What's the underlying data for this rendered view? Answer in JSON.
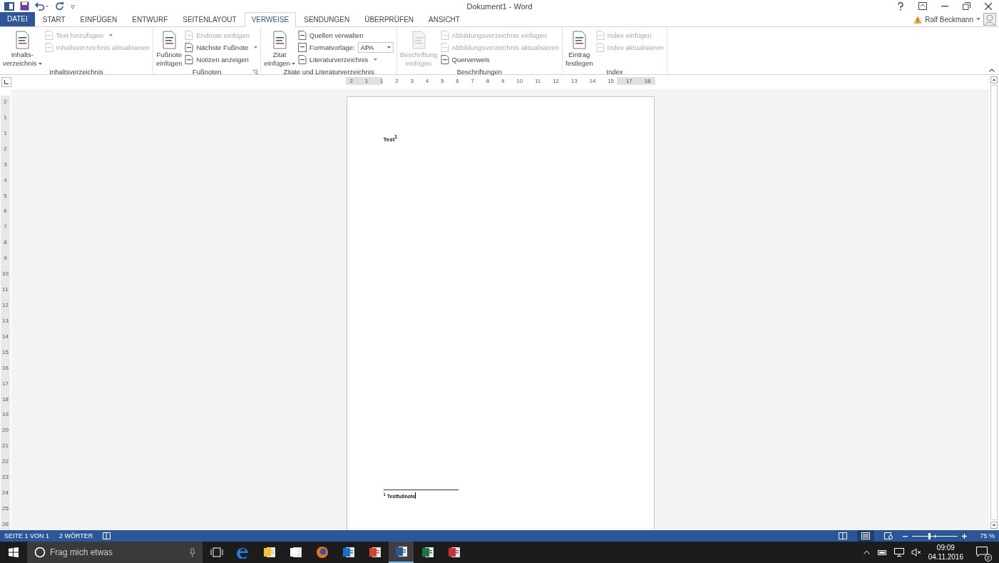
{
  "window": {
    "title": "Dokument1 - Word",
    "user": "Ralf Beckmann"
  },
  "tabs": [
    {
      "label": "DATEI",
      "kind": "file",
      "selected": false
    },
    {
      "label": "START",
      "kind": "tab",
      "selected": false
    },
    {
      "label": "EINFÜGEN",
      "kind": "tab",
      "selected": false
    },
    {
      "label": "ENTWURF",
      "kind": "tab",
      "selected": false
    },
    {
      "label": "SEITENLAYOUT",
      "kind": "tab",
      "selected": false
    },
    {
      "label": "VERWEISE",
      "kind": "tab",
      "selected": true
    },
    {
      "label": "SENDUNGEN",
      "kind": "tab",
      "selected": false
    },
    {
      "label": "ÜBERPRÜFEN",
      "kind": "tab",
      "selected": false
    },
    {
      "label": "ANSICHT",
      "kind": "tab",
      "selected": false
    }
  ],
  "ribbon": {
    "groups": [
      {
        "label": "Inhaltsverzeichnis",
        "large": [
          {
            "lines": [
              "Inhalts-",
              "verzeichnis"
            ],
            "disabled": false,
            "dropdown": true
          }
        ],
        "small": [
          {
            "label": "Text hinzufügen",
            "kind": "button",
            "disabled": true,
            "dropdown": true
          },
          {
            "label": "Inhaltsverzeichnis aktualisieren",
            "kind": "button",
            "disabled": true,
            "dropdown": false
          }
        ]
      },
      {
        "label": "Fußnoten",
        "launcher": true,
        "large": [
          {
            "lines": [
              "Fußnote",
              "einfügen"
            ],
            "disabled": false,
            "dropdown": false
          }
        ],
        "small": [
          {
            "label": "Endnote einfügen",
            "kind": "button",
            "disabled": true,
            "dropdown": false
          },
          {
            "label": "Nächste Fußnote",
            "kind": "button",
            "disabled": false,
            "dropdown": true
          },
          {
            "label": "Notizen anzeigen",
            "kind": "button",
            "disabled": false,
            "dropdown": false
          }
        ]
      },
      {
        "label": "Zitate und Literaturverzeichnis",
        "large": [
          {
            "lines": [
              "Zitat",
              "einfügen"
            ],
            "disabled": false,
            "dropdown": true
          }
        ],
        "small": [
          {
            "label": "Quellen verwalten",
            "kind": "button",
            "disabled": false,
            "dropdown": false
          },
          {
            "label": "Formatvorlage:",
            "kind": "select",
            "value": "APA"
          },
          {
            "label": "Literaturverzeichnis",
            "kind": "button",
            "disabled": false,
            "dropdown": true
          }
        ]
      },
      {
        "label": "Beschriftungen",
        "large": [
          {
            "lines": [
              "Beschriftung",
              "einfügen"
            ],
            "disabled": true,
            "dropdown": false
          }
        ],
        "small": [
          {
            "label": "Abbildungsverzeichnis einfügen",
            "kind": "button",
            "disabled": true,
            "dropdown": false
          },
          {
            "label": "Abbildungsverzeichnis aktualisieren",
            "kind": "button",
            "disabled": true,
            "dropdown": false
          },
          {
            "label": "Querverweis",
            "kind": "button",
            "disabled": false,
            "dropdown": false
          }
        ]
      },
      {
        "label": "Index",
        "large": [
          {
            "lines": [
              "Eintrag",
              "festlegen"
            ],
            "disabled": false,
            "dropdown": false
          }
        ],
        "small": [
          {
            "label": "Index einfügen",
            "kind": "button",
            "disabled": true,
            "dropdown": false
          },
          {
            "label": "Index aktualisieren",
            "kind": "button",
            "disabled": true,
            "dropdown": false
          }
        ]
      }
    ]
  },
  "ruler": {
    "horizontal": [
      "2",
      "1",
      "1",
      "2",
      "3",
      "4",
      "5",
      "6",
      "7",
      "8",
      "9",
      "10",
      "11",
      "12",
      "13",
      "14",
      "15",
      "17",
      "18"
    ],
    "vertical": [
      "2",
      "1",
      "1",
      "2",
      "3",
      "4",
      "5",
      "6",
      "7",
      "8",
      "9",
      "10",
      "11",
      "12",
      "13",
      "14",
      "15",
      "16",
      "17",
      "18",
      "19",
      "20",
      "21",
      "22",
      "23",
      "24",
      "25",
      "26"
    ]
  },
  "document": {
    "body": "Test$^{1}$",
    "footnote": "$^{1}$ Testfußnote"
  },
  "status_bar": {
    "page": "SEITE 1 VON 1",
    "words": "2 WÖRTER",
    "zoom": "75 %",
    "zoom_slider": {
      "level": 0.37
    }
  },
  "taskbar": {
    "search": {
      "placeholder": "Frag mich etwas"
    },
    "apps": [
      {
        "kind": "taskview",
        "selected": false
      },
      {
        "kind": "edge",
        "selected": false
      },
      {
        "kind": "explorer",
        "selected": false
      },
      {
        "kind": "store",
        "selected": false
      },
      {
        "kind": "firefox",
        "selected": false
      },
      {
        "kind": "outlook",
        "selected": false
      },
      {
        "kind": "powerpoint",
        "selected": false
      },
      {
        "kind": "word",
        "selected": true
      },
      {
        "kind": "excel",
        "selected": false
      },
      {
        "kind": "remote",
        "selected": false
      }
    ],
    "time": "09:09",
    "date": "04.11.2016",
    "notifications": "2"
  }
}
